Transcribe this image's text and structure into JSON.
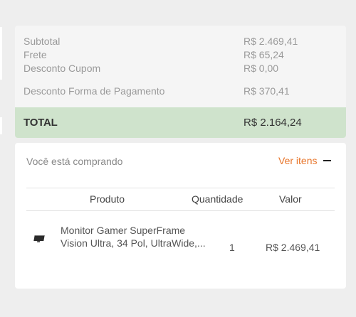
{
  "summary": {
    "subtotal_label": "Subtotal",
    "subtotal_value": "R$ 2.469,41",
    "shipping_label": "Frete",
    "shipping_value": "R$ 65,24",
    "coupon_label": "Desconto Cupom",
    "coupon_value": "R$ 0,00",
    "payment_discount_label": "Desconto Forma de Pagamento",
    "payment_discount_value": "R$ 370,41",
    "total_label": "TOTAL",
    "total_value": "R$ 2.164,24"
  },
  "purchase": {
    "heading": "Você está comprando",
    "toggle_label": "Ver itens",
    "toggle_icon": "minus-icon",
    "columns": [
      "Produto",
      "Quantidade",
      "Valor"
    ],
    "items": [
      {
        "name_line1": "Monitor Gamer SuperFrame",
        "name_line2": "Vision Ultra, 34 Pol, UltraWide,...",
        "thumbnail": "monitor-thumbnail",
        "quantity": "1",
        "value": "R$ 2.469,41"
      }
    ]
  },
  "colors": {
    "accent": "#e8762c",
    "total_bg": "#cfe3cc",
    "summary_bg": "#f5f5f5"
  }
}
